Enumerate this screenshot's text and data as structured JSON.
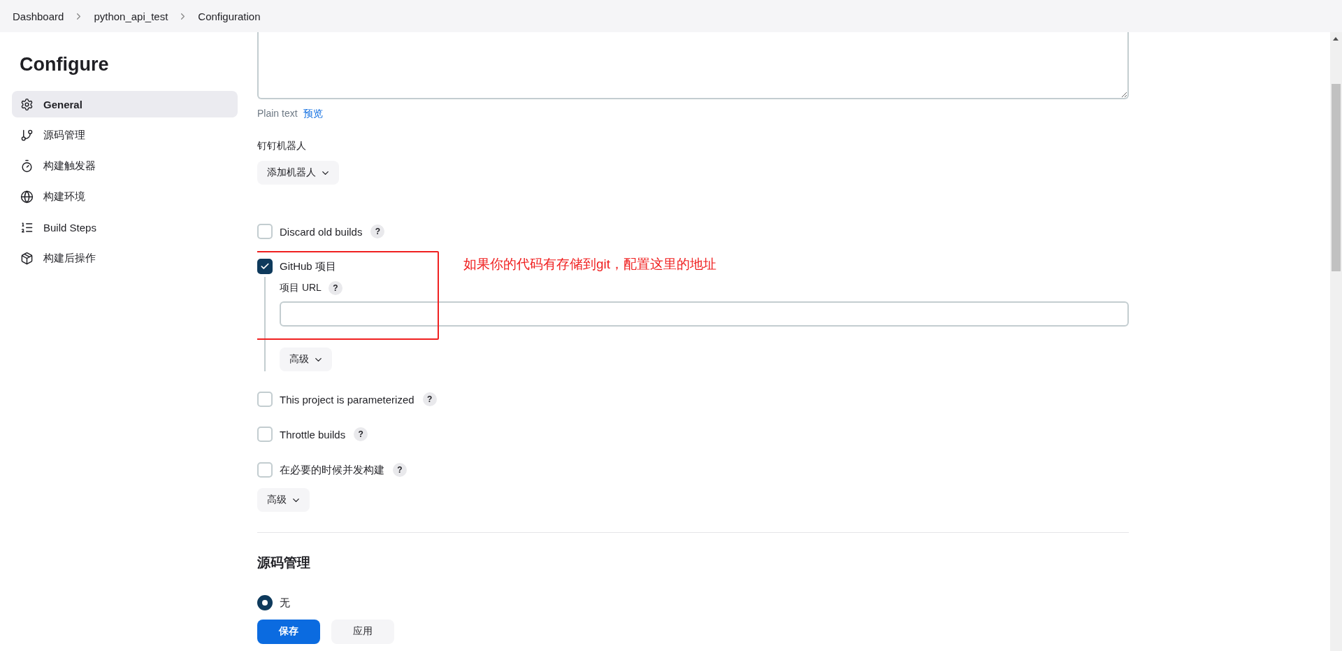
{
  "breadcrumbs": [
    "Dashboard",
    "python_api_test",
    "Configuration"
  ],
  "sidebar": {
    "title": "Configure",
    "items": [
      {
        "label": "General",
        "selected": true
      },
      {
        "label": "源码管理",
        "selected": false
      },
      {
        "label": "构建触发器",
        "selected": false
      },
      {
        "label": "构建环境",
        "selected": false
      },
      {
        "label": "Build Steps",
        "selected": false
      },
      {
        "label": "构建后操作",
        "selected": false
      }
    ]
  },
  "description": {
    "format_label": "Plain text",
    "preview_link": "预览"
  },
  "dingtalk": {
    "label": "钉钉机器人",
    "button": "添加机器人"
  },
  "options": [
    {
      "label": "Discard old builds",
      "checked": false,
      "help": "?"
    },
    {
      "label": "GitHub 项目",
      "checked": true,
      "sub": {
        "label": "项目 URL",
        "help": "?",
        "advanced": "高级"
      }
    },
    {
      "label": "This project is parameterized",
      "checked": false,
      "help": "?"
    },
    {
      "label": "Throttle builds",
      "checked": false,
      "help": "?"
    },
    {
      "label": "在必要的时候并发构建",
      "checked": false,
      "help": "?"
    }
  ],
  "advanced": "高级",
  "section": {
    "title": "源码管理",
    "radios": [
      {
        "label": "无",
        "selected": true
      }
    ]
  },
  "annotation": {
    "text": "如果你的代码有存储到git，配置这里的地址"
  },
  "buttons": [
    {
      "label": "保存",
      "kind": "primary"
    },
    {
      "label": "应用",
      "kind": "secondary"
    }
  ]
}
